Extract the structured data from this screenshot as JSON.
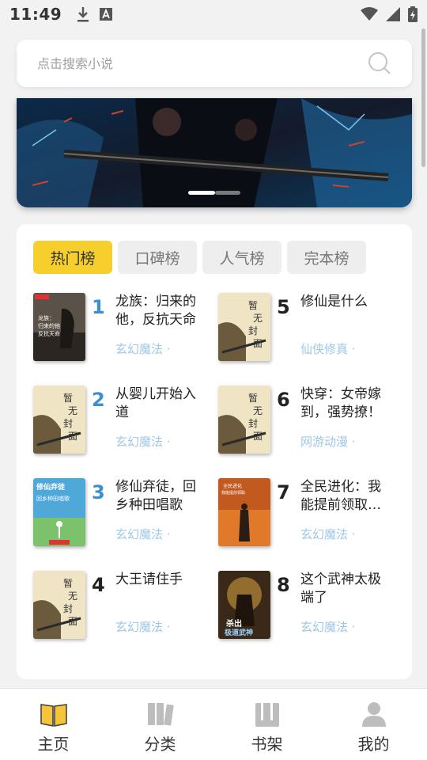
{
  "status": {
    "time": "11:49"
  },
  "search": {
    "placeholder": "点击搜索小说"
  },
  "tabs": [
    {
      "label": "热门榜",
      "active": true
    },
    {
      "label": "口碑榜",
      "active": false
    },
    {
      "label": "人气榜",
      "active": false
    },
    {
      "label": "完本榜",
      "active": false
    }
  ],
  "books": [
    {
      "rank": "1",
      "title": "龙族：归来的他，反抗天命",
      "tag": "玄幻魔法 ·",
      "cover_text": "龙族：归来的他，反抗天命"
    },
    {
      "rank": "2",
      "title": "从婴儿开始入道",
      "tag": "玄幻魔法 ·",
      "cover_text": "暂无封面"
    },
    {
      "rank": "3",
      "title": "修仙弃徒，回乡种田唱歌",
      "tag": "玄幻魔法 ·",
      "cover_text": "修仙弃徒 回乡种田唱歌"
    },
    {
      "rank": "4",
      "title": "大王请住手",
      "tag": "玄幻魔法 ·",
      "cover_text": "暂无封面"
    },
    {
      "rank": "5",
      "title": "修仙是什么",
      "tag": "仙侠修真 ·",
      "cover_text": "暂无封面"
    },
    {
      "rank": "6",
      "title": "快穿：女帝嫁到，强势撩！",
      "tag": "网游动漫 ·",
      "cover_text": "暂无封面"
    },
    {
      "rank": "7",
      "title": "全民进化：我能提前领取…",
      "tag": "玄幻魔法 ·",
      "cover_text": "全民进化：我能提前领取"
    },
    {
      "rank": "8",
      "title": "这个武神太极端了",
      "tag": "玄幻魔法 ·",
      "cover_text": "杀出极道武神"
    }
  ],
  "nav": [
    {
      "label": "主页",
      "icon": "book-open-icon",
      "active": true
    },
    {
      "label": "分类",
      "icon": "category-icon",
      "active": false
    },
    {
      "label": "书架",
      "icon": "bookshelf-icon",
      "active": false
    },
    {
      "label": "我的",
      "icon": "profile-icon",
      "active": false
    }
  ],
  "colors": {
    "accent": "#f7cf2d",
    "rank_top": "#3b8fd0",
    "tag": "#9fc7e6"
  }
}
